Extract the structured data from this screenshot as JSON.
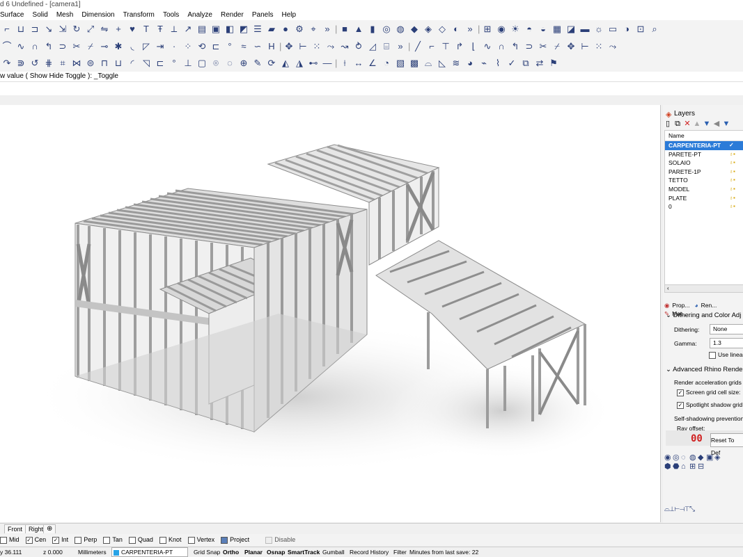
{
  "window": {
    "title": "d 6 Undefined - [camera1]"
  },
  "menu": {
    "items": [
      "Surface",
      "Solid",
      "Mesh",
      "Dimension",
      "Transform",
      "Tools",
      "Analyze",
      "Render",
      "Panels",
      "Help"
    ]
  },
  "command": {
    "prompt": "w value ( Show  Hide  Toggle ): _Toggle"
  },
  "layers": {
    "panel_title": "Layers",
    "name_header": "Name",
    "items": [
      {
        "name": "CARPENTERIA-PT",
        "current": true
      },
      {
        "name": "PARETE-PT"
      },
      {
        "name": "SOLAIO"
      },
      {
        "name": "PARETE-1P"
      },
      {
        "name": "TETTO"
      },
      {
        "name": "MODEL"
      },
      {
        "name": "PLATE"
      },
      {
        "name": "0"
      }
    ]
  },
  "props": {
    "tabs": [
      "Prop...",
      "Ren...",
      "Mat..."
    ],
    "dither_section": "Dithering and Color Adj",
    "dither_label": "Dithering:",
    "dither_value": "None",
    "gamma_label": "Gamma:",
    "gamma_value": "1.3",
    "linear_label": "Use linear",
    "advanced_section": "Advanced Rhino Render",
    "accel_label": "Render acceleration grids",
    "screen_grid": "Screen grid cell size:",
    "spot_grid": "Spotlight shadow grid si",
    "self_shadow": "Self-shadowing prevention",
    "ray_offset": "Ray offset:",
    "reset_button": "Reset To Def",
    "reset_icon_text": "00"
  },
  "viewport_tabs": [
    "Front",
    "Right"
  ],
  "osnaps": [
    {
      "label": "Mid",
      "checked": false
    },
    {
      "label": "Cen",
      "checked": true
    },
    {
      "label": "Int",
      "checked": true
    },
    {
      "label": "Perp",
      "checked": false
    },
    {
      "label": "Tan",
      "checked": false
    },
    {
      "label": "Quad",
      "checked": false
    },
    {
      "label": "Knot",
      "checked": false
    },
    {
      "label": "Vertex",
      "checked": false
    },
    {
      "label": "Project",
      "checked": true
    },
    {
      "label": "Disable",
      "checked": false
    }
  ],
  "status": {
    "y": "y 36.111",
    "z": "z 0.000",
    "units": "Millimeters",
    "layer": "CARPENTERIA-PT",
    "layer_color": "#29a3e6",
    "grid_snap": "Grid Snap",
    "ortho": "Ortho",
    "planar": "Planar",
    "osnap": "Osnap",
    "smarttrack": "SmartTrack",
    "gumball": "Gumball",
    "record_history": "Record History",
    "filter": "Filter",
    "save_msg": "Minutes from last save: 22"
  },
  "colors": {
    "accent": "#2b7bd8",
    "icon": "#2b3f78"
  }
}
